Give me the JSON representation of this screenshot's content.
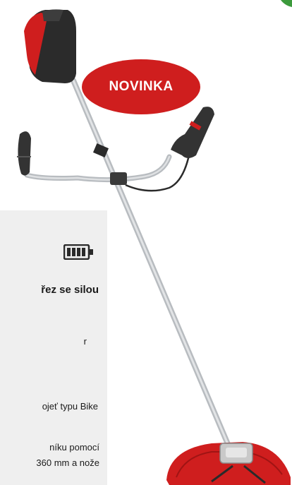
{
  "badge": {
    "label": "NOVINKA",
    "color": "#cf1e1e"
  },
  "panel": {
    "heading": "řez se silou",
    "lines": [
      "r",
      "ojeť typu Bike",
      "níku pomocí",
      "360 mm a nože"
    ]
  },
  "icons": {
    "battery": "battery-icon"
  },
  "colors": {
    "accent": "#cf1e1e",
    "panel_bg": "#efefef"
  }
}
